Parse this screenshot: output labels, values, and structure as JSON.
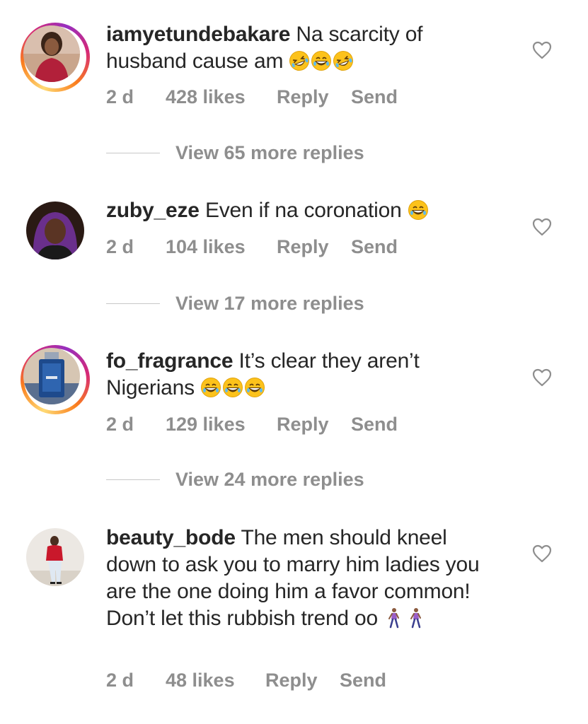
{
  "comments": [
    {
      "username": "iamyetundebakare",
      "text": "Na scarcity of husband cause am",
      "emojis": [
        "rolling-laughing",
        "grinning-sweat",
        "rolling-laughing"
      ],
      "time": "2 d",
      "likes": "428 likes",
      "reply": "Reply",
      "send": "Send",
      "view_replies": "View 65 more replies"
    },
    {
      "username": "zuby_eze",
      "text": "Even if na coronation",
      "emojis": [
        "grinning-sweat"
      ],
      "time": "2 d",
      "likes": "104 likes",
      "reply": "Reply",
      "send": "Send",
      "view_replies": "View 17 more replies"
    },
    {
      "username": "fo_fragrance",
      "text": "It’s clear they aren’t Nigerians",
      "emojis": [
        "grinning-sweat",
        "grinning-sweat",
        "grinning-sweat"
      ],
      "time": "2 d",
      "likes": "129 likes",
      "reply": "Reply",
      "send": "Send",
      "view_replies": "View 24 more replies"
    },
    {
      "username": "beauty_bode",
      "text": "The men should kneel down to ask you to marry him ladies you are the one doing him a favor common! Don’t let this rubbish trend oo",
      "emojis": [
        "woman-walking",
        "woman-walking"
      ],
      "time": "2 d",
      "likes": "48 likes",
      "reply": "Reply",
      "send": "Send"
    }
  ],
  "colors": {
    "text": "#262626",
    "meta": "#8e8e8e",
    "divider": "#c7c7c7",
    "story_ring": "#d62976"
  },
  "icons": {
    "like": "heart-outline-icon"
  }
}
